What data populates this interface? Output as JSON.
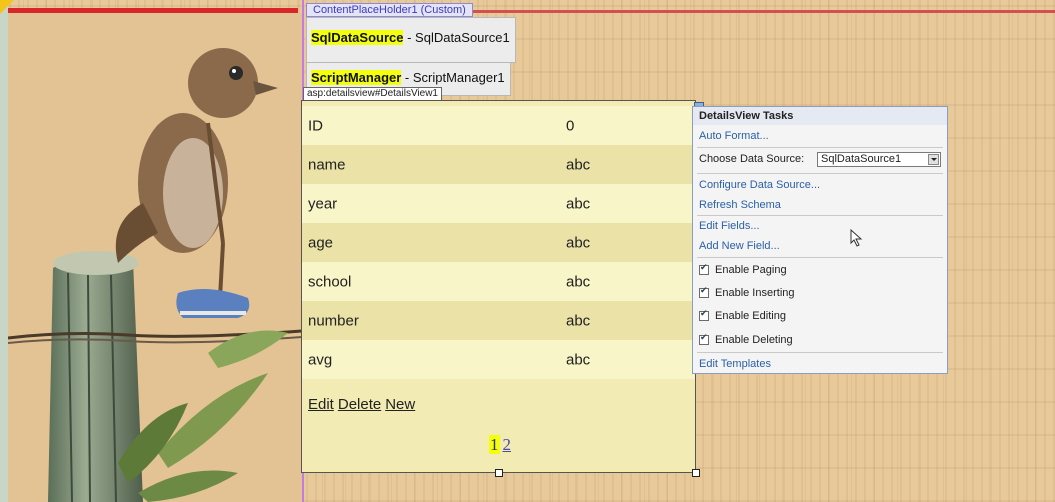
{
  "content_placeholder": {
    "label": "ContentPlaceHolder1 (Custom)"
  },
  "controls": {
    "sql_data_source": {
      "type": "SqlDataSource",
      "id": " - SqlDataSource1"
    },
    "script_manager": {
      "type": "ScriptManager",
      "id": " - ScriptManager1"
    }
  },
  "details_view": {
    "tag": "asp:detailsview#DetailsView1",
    "rows": [
      {
        "field": "ID",
        "value": "0"
      },
      {
        "field": "name",
        "value": "abc"
      },
      {
        "field": "year",
        "value": "abc"
      },
      {
        "field": "age",
        "value": "abc"
      },
      {
        "field": "school",
        "value": "abc"
      },
      {
        "field": "number",
        "value": "abc"
      },
      {
        "field": "avg",
        "value": "abc"
      }
    ],
    "commands": {
      "edit": "Edit",
      "delete": "Delete",
      "new": "New"
    },
    "pager": {
      "current": "1",
      "next": "2"
    }
  },
  "tasks_panel": {
    "title": "DetailsView Tasks",
    "auto_format": "Auto Format...",
    "choose_data_source_label": "Choose Data Source:",
    "choose_data_source_value": "SqlDataSource1",
    "configure_data_source": "Configure Data Source...",
    "refresh_schema": "Refresh Schema",
    "edit_fields": "Edit Fields...",
    "add_new_field": "Add New Field...",
    "enable_paging": "Enable Paging",
    "enable_inserting": "Enable Inserting",
    "enable_editing": "Enable Editing",
    "enable_deleting": "Enable Deleting",
    "edit_templates": "Edit Templates"
  },
  "colors": {
    "accent_highlight": "#f4ff10",
    "row_light": "#f8f5c8",
    "row_alt": "#ebe2a8",
    "link_blue": "#2a5fa8"
  }
}
